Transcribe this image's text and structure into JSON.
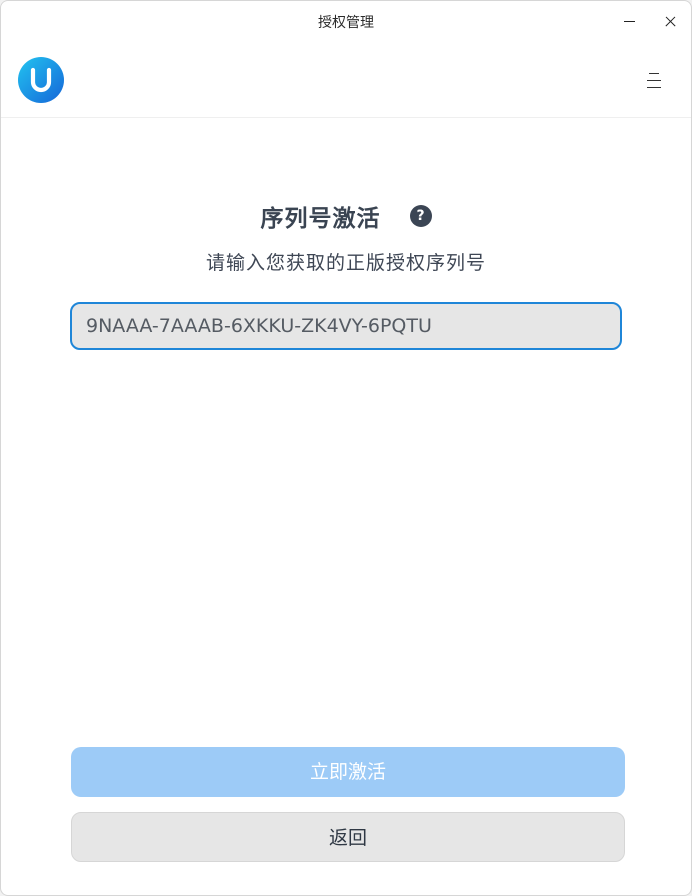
{
  "window": {
    "title": "授权管理"
  },
  "header": {
    "logo_icon": "uos-logo-icon",
    "menu_icon": "hamburger-menu-icon"
  },
  "main": {
    "heading": "序列号激活",
    "help_icon": "question-icon",
    "help_glyph": "?",
    "subtitle": "请输入您获取的正版授权序列号",
    "serial_value": "9NAAA-7AAAB-6XKKU-ZK4VY-6PQTU"
  },
  "buttons": {
    "activate_label": "立即激活",
    "back_label": "返回"
  },
  "colors": {
    "accent": "#1f86d8",
    "activate_disabled": "#9dcbf7",
    "heading_text": "#3a4452"
  }
}
